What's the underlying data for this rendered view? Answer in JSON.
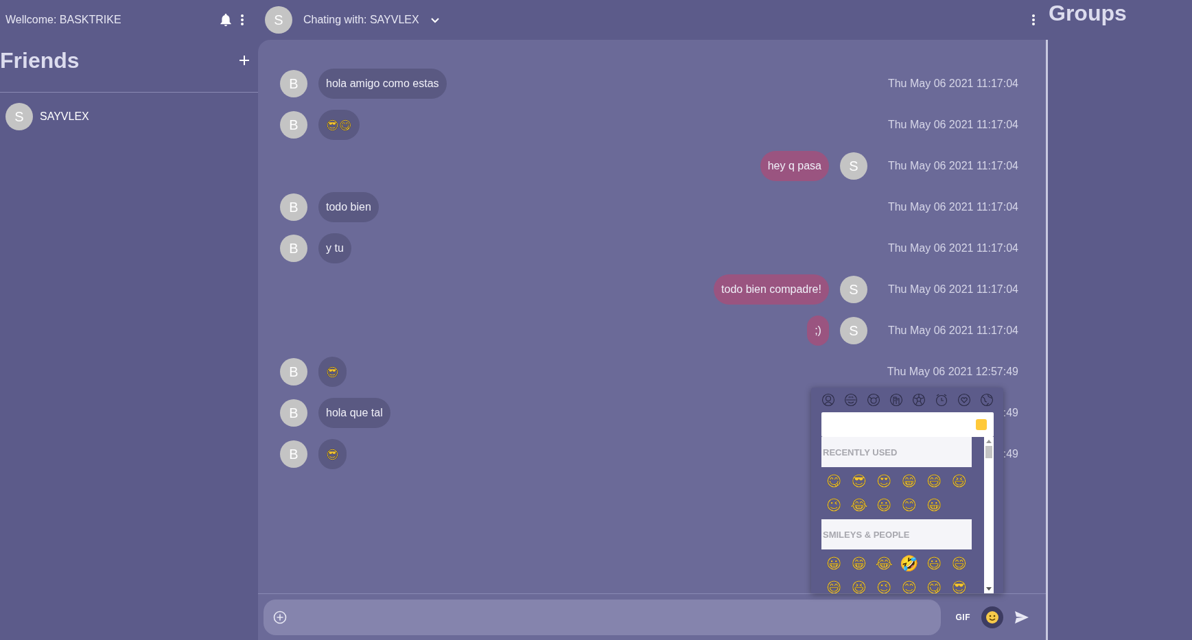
{
  "header": {
    "welcome": "Wellcome: BASKTRIKE",
    "chat_avatar": "S",
    "chat_title": "Chating with: SAYVLEX"
  },
  "friends": {
    "title": "Friends",
    "items": [
      {
        "avatar": "S",
        "name": "SAYVLEX"
      }
    ]
  },
  "groups": {
    "title": "Groups"
  },
  "messages": [
    {
      "kind": "incoming",
      "avatar": "B",
      "text": "hola amigo como estas",
      "time": "Thu May 06 2021 11:17:04"
    },
    {
      "kind": "incoming",
      "avatar": "B",
      "text": "😎😋",
      "time": "Thu May 06 2021 11:17:04"
    },
    {
      "kind": "outgoing",
      "avatar": "S",
      "text": "hey q pasa",
      "time": "Thu May 06 2021 11:17:04"
    },
    {
      "kind": "incoming",
      "avatar": "B",
      "text": "todo bien",
      "time": "Thu May 06 2021 11:17:04"
    },
    {
      "kind": "incoming",
      "avatar": "B",
      "text": "y tu",
      "time": "Thu May 06 2021 11:17:04"
    },
    {
      "kind": "outgoing",
      "avatar": "S",
      "text": "todo bien compadre!",
      "time": "Thu May 06 2021 11:17:04"
    },
    {
      "kind": "outgoing",
      "avatar": "S",
      "text": ";)",
      "time": "Thu May 06 2021 11:17:04"
    },
    {
      "kind": "incoming",
      "avatar": "B",
      "text": "😎",
      "time": "Thu May 06 2021 12:57:49"
    },
    {
      "kind": "incoming",
      "avatar": "B",
      "text": "hola que tal",
      "time": ":49"
    },
    {
      "kind": "incoming",
      "avatar": "B",
      "text": "😎",
      "time": ":49"
    }
  ],
  "emoji_picker": {
    "sections": [
      {
        "title": "RECENTLY USED",
        "emojis": [
          "😋",
          "😎",
          "😍",
          "😁",
          "😅",
          "😆",
          "😉",
          "😂",
          "😃",
          "😊",
          "😀"
        ]
      },
      {
        "title": "SMILEYS & PEOPLE",
        "emojis": [
          "😀",
          "😁",
          "😂",
          "🤣",
          "😃",
          "😄",
          "😅",
          "😆",
          "😉",
          "😊",
          "😋",
          "😎"
        ]
      }
    ]
  },
  "composer": {
    "gif": "GIF"
  }
}
